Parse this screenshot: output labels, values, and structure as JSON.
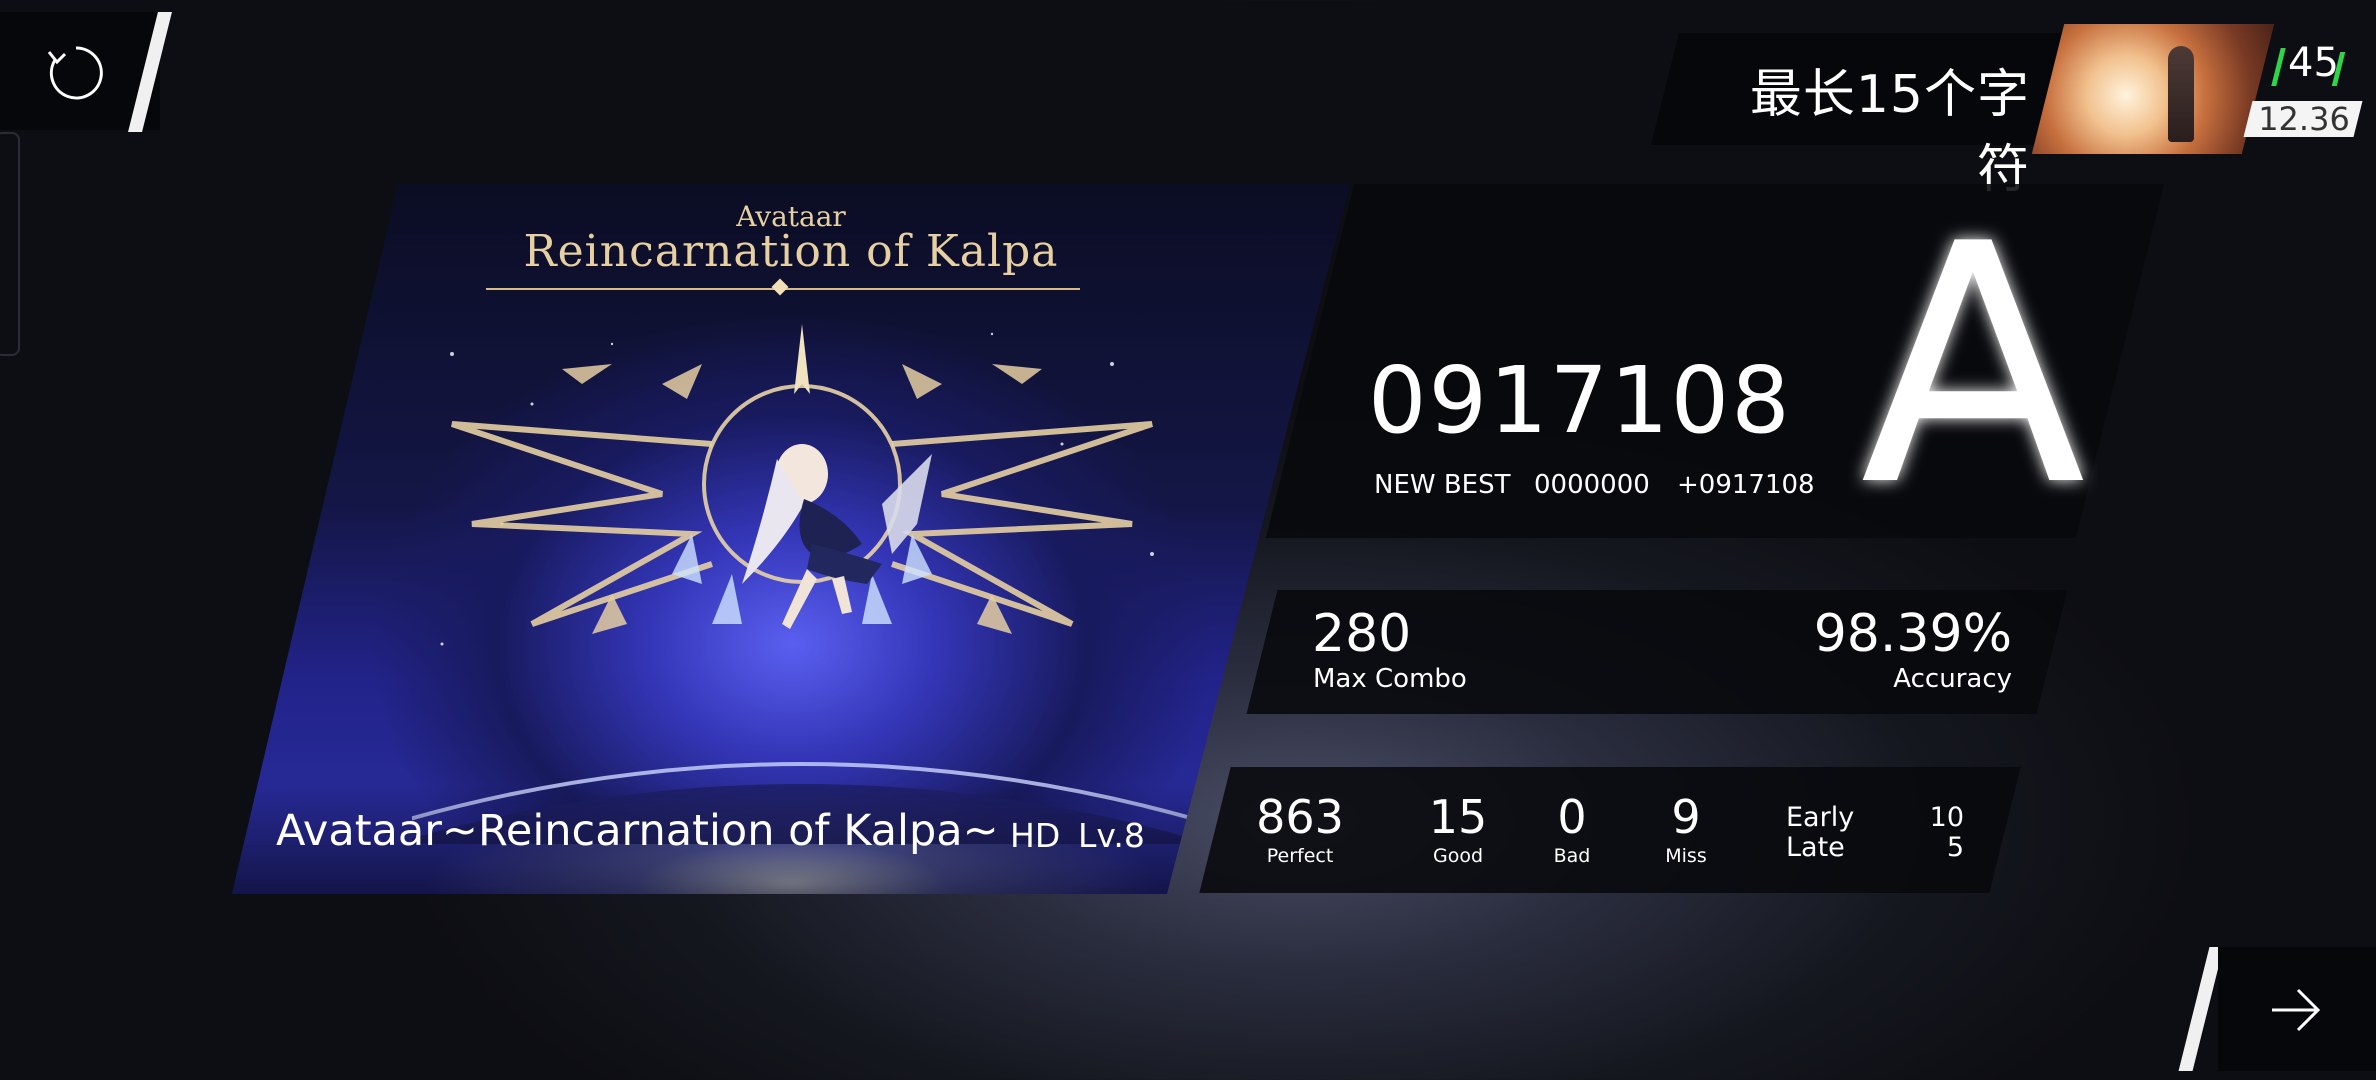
{
  "player": {
    "name": "最长15个字符",
    "rks": "45",
    "level": "12.36"
  },
  "song": {
    "cover_title_small": "Avataar",
    "cover_title_main": "Reincarnation of Kalpa",
    "title": "Avataar~Reincarnation of Kalpa~",
    "difficulty": "HD",
    "level": "Lv.8"
  },
  "result": {
    "score": "0917108",
    "new_best_label": "NEW BEST",
    "previous_best": "0000000",
    "score_delta": "+0917108",
    "grade": "A",
    "max_combo": "280",
    "max_combo_label": "Max Combo",
    "accuracy": "98.39%",
    "accuracy_label": "Accuracy"
  },
  "judgements": {
    "perfect": "863",
    "perfect_label": "Perfect",
    "good": "15",
    "good_label": "Good",
    "bad": "0",
    "bad_label": "Bad",
    "miss": "9",
    "miss_label": "Miss",
    "early_label": "Early",
    "late_label": "Late",
    "early": "10",
    "late": "5"
  },
  "icons": {
    "retry": "retry-icon",
    "next": "arrow-right-icon"
  },
  "colors": {
    "rks_accent": "#2fd44b",
    "cover_gold": "#e6cfa1"
  }
}
